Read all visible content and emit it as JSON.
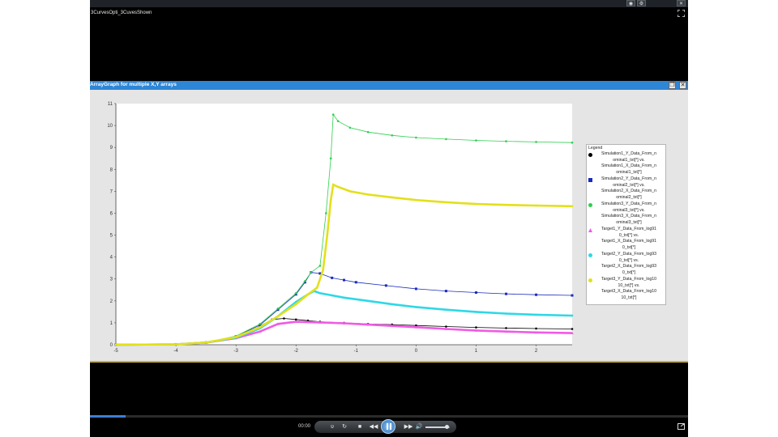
{
  "player": {
    "clip_title": "3CurvesOpti_3CuvesShown",
    "time": "00:00",
    "progress": 0.06,
    "volume": 0.85
  },
  "graph_window": {
    "title": "ArrayGraph for multiple X,Y arrays"
  },
  "icons": {
    "window_buttons": [
      "eye-icon",
      "gear-icon",
      "close-icon"
    ],
    "fullscreen": "fullscreen-icon",
    "controls": [
      "loop-icon",
      "refresh-icon",
      "stop-icon",
      "rewind-icon",
      "pause-icon",
      "fast-forward-icon",
      "volume-icon"
    ],
    "expand": "expand-icon"
  },
  "colors": {
    "sim1": "#000000",
    "sim2": "#1b2bbd",
    "sim3": "#2fcf4f",
    "target1": "#f05ae6",
    "target2": "#2fd8e6",
    "target3": "#e3e01b",
    "titlebar": "#2e86d6"
  },
  "chart_data": {
    "type": "scatter",
    "xlim": [
      -5,
      2.6
    ],
    "ylim": [
      0,
      11
    ],
    "xticks": [
      "-5",
      "-4",
      "-3",
      "-2",
      "-1",
      "0",
      "1",
      "2"
    ],
    "yticks": [
      "0",
      "1",
      "2",
      "3",
      "4",
      "5",
      "6",
      "7",
      "8",
      "9",
      "10",
      "11"
    ],
    "legend_title": "Legend",
    "legend_position": "right",
    "series": [
      {
        "name": "Simulation1_Y_Data_From_nominal1_txt[*] vs. Simulation1_X_Data_From_nominal1_txt[*]",
        "label": "Simulation1_Y_Data_From_n\nominal1_txt[*] vs.\nSimulation1_X_Data_From_n\nominal1_txt[*]",
        "color": "#000000",
        "marker": "circle",
        "x": [
          -5,
          -4,
          -3.5,
          -3,
          -2.8,
          -2.6,
          -2.4,
          -2.2,
          -2.0,
          -1.8,
          -1.6,
          -1.2,
          -0.8,
          -0.4,
          0,
          0.5,
          1,
          1.5,
          2,
          2.6
        ],
        "y": [
          0,
          0.02,
          0.1,
          0.35,
          0.55,
          0.85,
          1.15,
          1.2,
          1.15,
          1.1,
          1.05,
          1.0,
          0.95,
          0.92,
          0.88,
          0.83,
          0.79,
          0.76,
          0.74,
          0.72
        ]
      },
      {
        "name": "Simulation2_Y_Data_From_nominal2_txt[*] vs. Simulation2_X_Data_From_nominal2_txt[*]",
        "label": "Simulation2_Y_Data_From_n\nominal2_txt[*] vs.\nSimulation2_X_Data_From_n\nominal2_txt[*]",
        "color": "#1b2bbd",
        "marker": "square",
        "x": [
          -5,
          -4,
          -3.5,
          -3,
          -2.6,
          -2.3,
          -2.0,
          -1.85,
          -1.75,
          -1.6,
          -1.4,
          -1.2,
          -1.0,
          -0.5,
          0,
          0.5,
          1,
          1.5,
          2,
          2.6
        ],
        "y": [
          0,
          0.02,
          0.1,
          0.38,
          0.9,
          1.6,
          2.3,
          2.85,
          3.3,
          3.25,
          3.05,
          2.95,
          2.85,
          2.7,
          2.55,
          2.45,
          2.38,
          2.32,
          2.28,
          2.25
        ]
      },
      {
        "name": "Simulation3_Y_Data_From_nominal3_txt[*] vs. Simulation3_X_Data_From_nominal3_txt[*]",
        "label": "Simulation3_Y_Data_From_n\nominal3_txt[*] vs.\nSimulation3_X_Data_From_n\nominal3_txt[*]",
        "color": "#2fcf4f",
        "marker": "circle",
        "x": [
          -5,
          -4,
          -3.5,
          -3,
          -2.6,
          -2.3,
          -2.0,
          -1.85,
          -1.75,
          -1.6,
          -1.5,
          -1.42,
          -1.38,
          -1.3,
          -1.1,
          -0.8,
          -0.4,
          0,
          0.5,
          1,
          1.5,
          2,
          2.6
        ],
        "y": [
          0,
          0.02,
          0.1,
          0.4,
          0.95,
          1.65,
          2.35,
          2.9,
          3.3,
          3.6,
          6.0,
          8.5,
          10.5,
          10.2,
          9.9,
          9.7,
          9.55,
          9.45,
          9.38,
          9.32,
          9.28,
          9.25,
          9.22
        ]
      },
      {
        "name": "Target1_Y_Data_From_log910_txt[*] vs. Target1_X_Data_From_log910_txt[*]",
        "label": "Target1_Y_Data_From_log91\n0_txt[*] vs.\nTarget1_X_Data_From_log91\n0_txt[*]",
        "color": "#f05ae6",
        "marker": "triangle",
        "x": [
          -5,
          -4,
          -3.5,
          -3,
          -2.6,
          -2.3,
          -2.0,
          -1.6,
          -1.2,
          -0.8,
          -0.4,
          0,
          0.5,
          1,
          1.5,
          2,
          2.6
        ],
        "y": [
          0,
          0.02,
          0.1,
          0.3,
          0.6,
          0.95,
          1.05,
          1.02,
          0.98,
          0.92,
          0.86,
          0.8,
          0.72,
          0.65,
          0.6,
          0.56,
          0.53
        ]
      },
      {
        "name": "Target2_Y_Data_From_log930_txt[*] vs. Target2_X_Data_From_log930_txt[*]",
        "label": "Target2_Y_Data_From_log93\n0_txt[*] vs.\nTarget2_X_Data_From_log93\n0_txt[*]",
        "color": "#2fd8e6",
        "marker": "circle",
        "x": [
          -5,
          -4,
          -3.5,
          -3,
          -2.6,
          -2.3,
          -2.0,
          -1.8,
          -1.7,
          -1.6,
          -1.4,
          -1.2,
          -0.8,
          -0.4,
          0,
          0.5,
          1,
          1.5,
          2,
          2.6
        ],
        "y": [
          0,
          0.02,
          0.1,
          0.32,
          0.75,
          1.3,
          1.95,
          2.3,
          2.45,
          2.35,
          2.25,
          2.15,
          2.0,
          1.85,
          1.72,
          1.6,
          1.5,
          1.42,
          1.37,
          1.33
        ]
      },
      {
        "name": "Target3_Y_Data_From_log1010_txt[*] vs. Target3_X_Data_From_log1010_txt[*]",
        "label": "Target3_Y_Data_From_log10\n10_txt[*] vs.\nTarget3_X_Data_From_log10\n10_txt[*]",
        "color": "#e3e01b",
        "marker": "circle",
        "x": [
          -5,
          -4,
          -3.5,
          -3,
          -2.6,
          -2.3,
          -2.0,
          -1.8,
          -1.65,
          -1.55,
          -1.48,
          -1.42,
          -1.38,
          -1.3,
          -1.1,
          -0.8,
          -0.4,
          0,
          0.5,
          1,
          1.5,
          2,
          2.6
        ],
        "y": [
          0,
          0.02,
          0.1,
          0.35,
          0.8,
          1.3,
          1.85,
          2.3,
          2.6,
          3.4,
          5.0,
          6.6,
          7.3,
          7.2,
          7.0,
          6.85,
          6.72,
          6.6,
          6.5,
          6.42,
          6.38,
          6.35,
          6.32
        ]
      }
    ]
  }
}
